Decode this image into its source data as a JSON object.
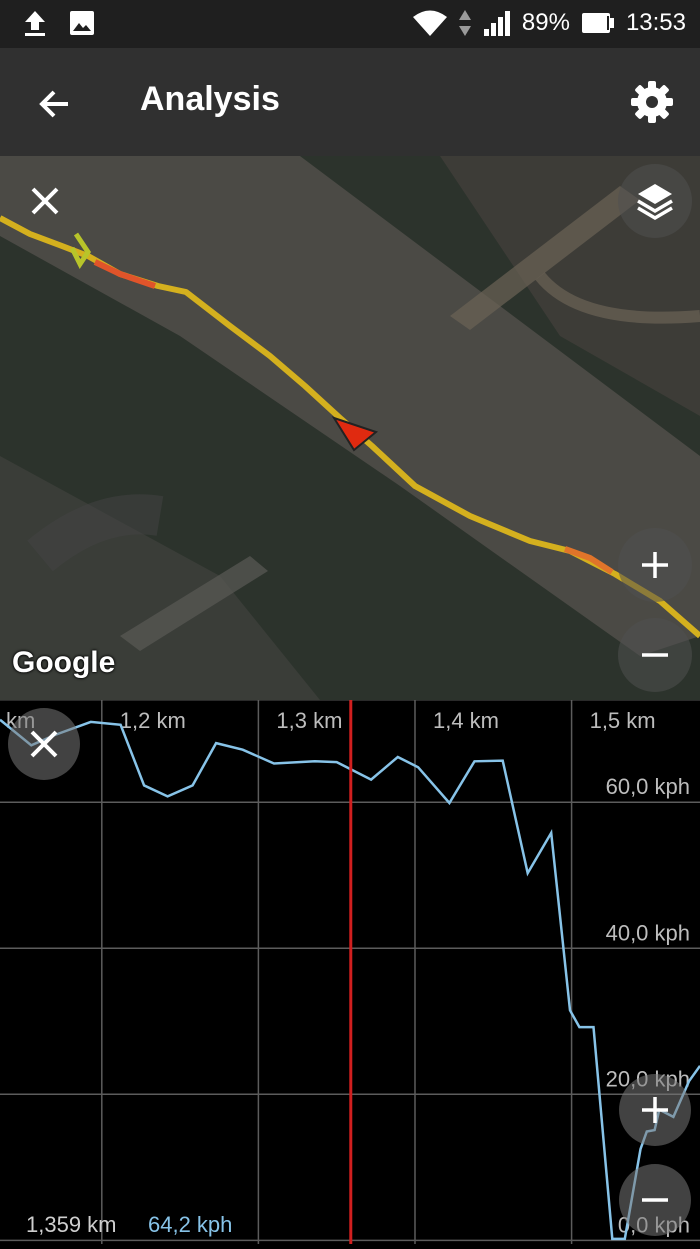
{
  "status_bar": {
    "battery": "89%",
    "time": "13:53",
    "icons": [
      "upload-icon",
      "image-icon",
      "wifi-icon",
      "data-arrows-icon",
      "signal-icon",
      "battery-icon"
    ]
  },
  "app_bar": {
    "title": "Analysis",
    "back_icon": "arrow-back-icon",
    "settings_icon": "gear-icon"
  },
  "map": {
    "attribution": "Google",
    "controls": [
      "close-icon",
      "layers-icon",
      "zoom-in-icon",
      "zoom-out-icon"
    ],
    "track_color": "#d4b01e",
    "track_fast_color": "#e0542a",
    "marker_color": "#e02a10"
  },
  "chart_data": {
    "type": "line",
    "x_unit": "km",
    "y_unit": "kph",
    "x_ticks": [
      "km",
      "1,2 km",
      "1,3 km",
      "1,4 km",
      "1,5 km"
    ],
    "y_ticks": [
      "60,0 kph",
      "40,0 kph",
      "20,0 kph",
      "0,0 kph"
    ],
    "xlim": [
      1.135,
      1.582
    ],
    "ylim": [
      -0.5,
      74
    ],
    "grid": true,
    "cursor_x": 1.359,
    "line_color": "#87c3e8",
    "cursor_color": "#d11f1f",
    "series": [
      {
        "x": [
          1.135,
          1.155,
          1.17,
          1.193,
          1.212,
          1.227,
          1.242,
          1.258,
          1.273,
          1.29,
          1.31,
          1.336,
          1.35,
          1.372,
          1.389,
          1.402,
          1.422,
          1.438,
          1.456,
          1.472,
          1.487,
          1.499,
          1.505,
          1.514,
          1.526,
          1.534,
          1.544,
          1.548,
          1.553,
          1.556,
          1.565,
          1.575,
          1.582
        ],
        "y": [
          71.3,
          67.8,
          69.2,
          71,
          70.6,
          62.3,
          60.8,
          62.3,
          68.1,
          67.2,
          65.3,
          65.6,
          65.5,
          63.1,
          66.2,
          64.8,
          59.9,
          65.6,
          65.7,
          50.3,
          55.8,
          31.5,
          29.2,
          29.2,
          0.2,
          0.2,
          12.5,
          14.9,
          15.1,
          17.9,
          16.9,
          21.8,
          23.9
        ]
      }
    ]
  },
  "readout": {
    "distance": "1,359 km",
    "speed": "64,2 kph"
  },
  "chart_controls": [
    "close-icon",
    "zoom-in-icon",
    "zoom-out-icon"
  ]
}
